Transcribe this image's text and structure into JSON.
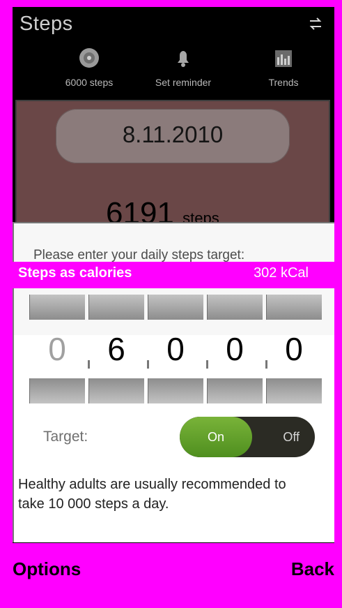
{
  "app": {
    "title": "Steps"
  },
  "toolbar": {
    "items": [
      {
        "label": "6000 steps",
        "icon": "target-icon"
      },
      {
        "label": "Set reminder",
        "icon": "bell-icon"
      },
      {
        "label": "Trends",
        "icon": "chart-icon"
      }
    ]
  },
  "main": {
    "date": "8.11.2010",
    "steps_count_prefix": "6191",
    "steps_unit": "steps"
  },
  "dialog": {
    "prompt": "Please enter your daily steps target:",
    "steps_as_calories_label": "Steps as calories",
    "steps_as_calories_value": "302 kCal",
    "digits": [
      "0",
      "6",
      "0",
      "0",
      "0"
    ],
    "target_label": "Target:",
    "toggle": {
      "on_label": "On",
      "off_label": "Off",
      "state": "On"
    },
    "advice": "Healthy adults are usually recommended to take 10 000 steps a day."
  },
  "softkeys": {
    "left": "Options",
    "right": "Back"
  },
  "colors": {
    "magenta": "#ff00ff",
    "toggle_on": "#5f9f2c",
    "toggle_track": "#2b2b24"
  }
}
